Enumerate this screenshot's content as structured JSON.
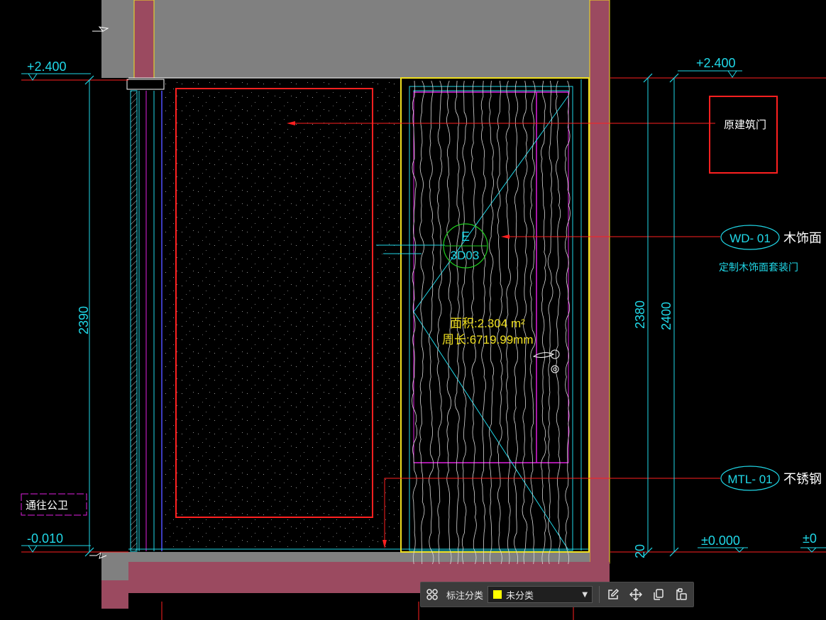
{
  "drawing": {
    "level_top_left": "+2.400",
    "level_top_right": "+2.400",
    "level_bottom_left": "-0.010",
    "level_bottom_right": "±0.000",
    "level_bottom_far_right": "±0",
    "dim_left_height": "2390",
    "dim_right_inner": "2380",
    "dim_right_outer": "2400",
    "dim_right_small": "20",
    "callout_existing_door": "原建筑门",
    "section_tag_letter": "E",
    "section_tag_number": "3D03",
    "area_label": "面积:2.304 m²",
    "perimeter_label": "周长:6719.99mm",
    "material_wd": "WD- 01",
    "material_wd_name": "木饰面",
    "material_wd_desc": "定制木饰面套装门",
    "material_mtl": "MTL- 01",
    "material_mtl_name": "不锈钢",
    "room_label": "通往公卫"
  },
  "colors": {
    "wall_fill": "#9b4a60",
    "slab_fill": "#808080",
    "red": "#ff2020",
    "cyan": "#20d8e8",
    "yellow": "#f0e020",
    "magenta": "#e020e0",
    "green": "#20d020"
  },
  "toolbar": {
    "grid_icon": "grid-icon",
    "label": "标注分类",
    "category_value": "未分类",
    "category_color": "#ffff00",
    "edit_icon": "edit-icon",
    "move_icon": "move-icon",
    "copy_icon": "copy-icon",
    "paste_icon": "paste-icon"
  }
}
